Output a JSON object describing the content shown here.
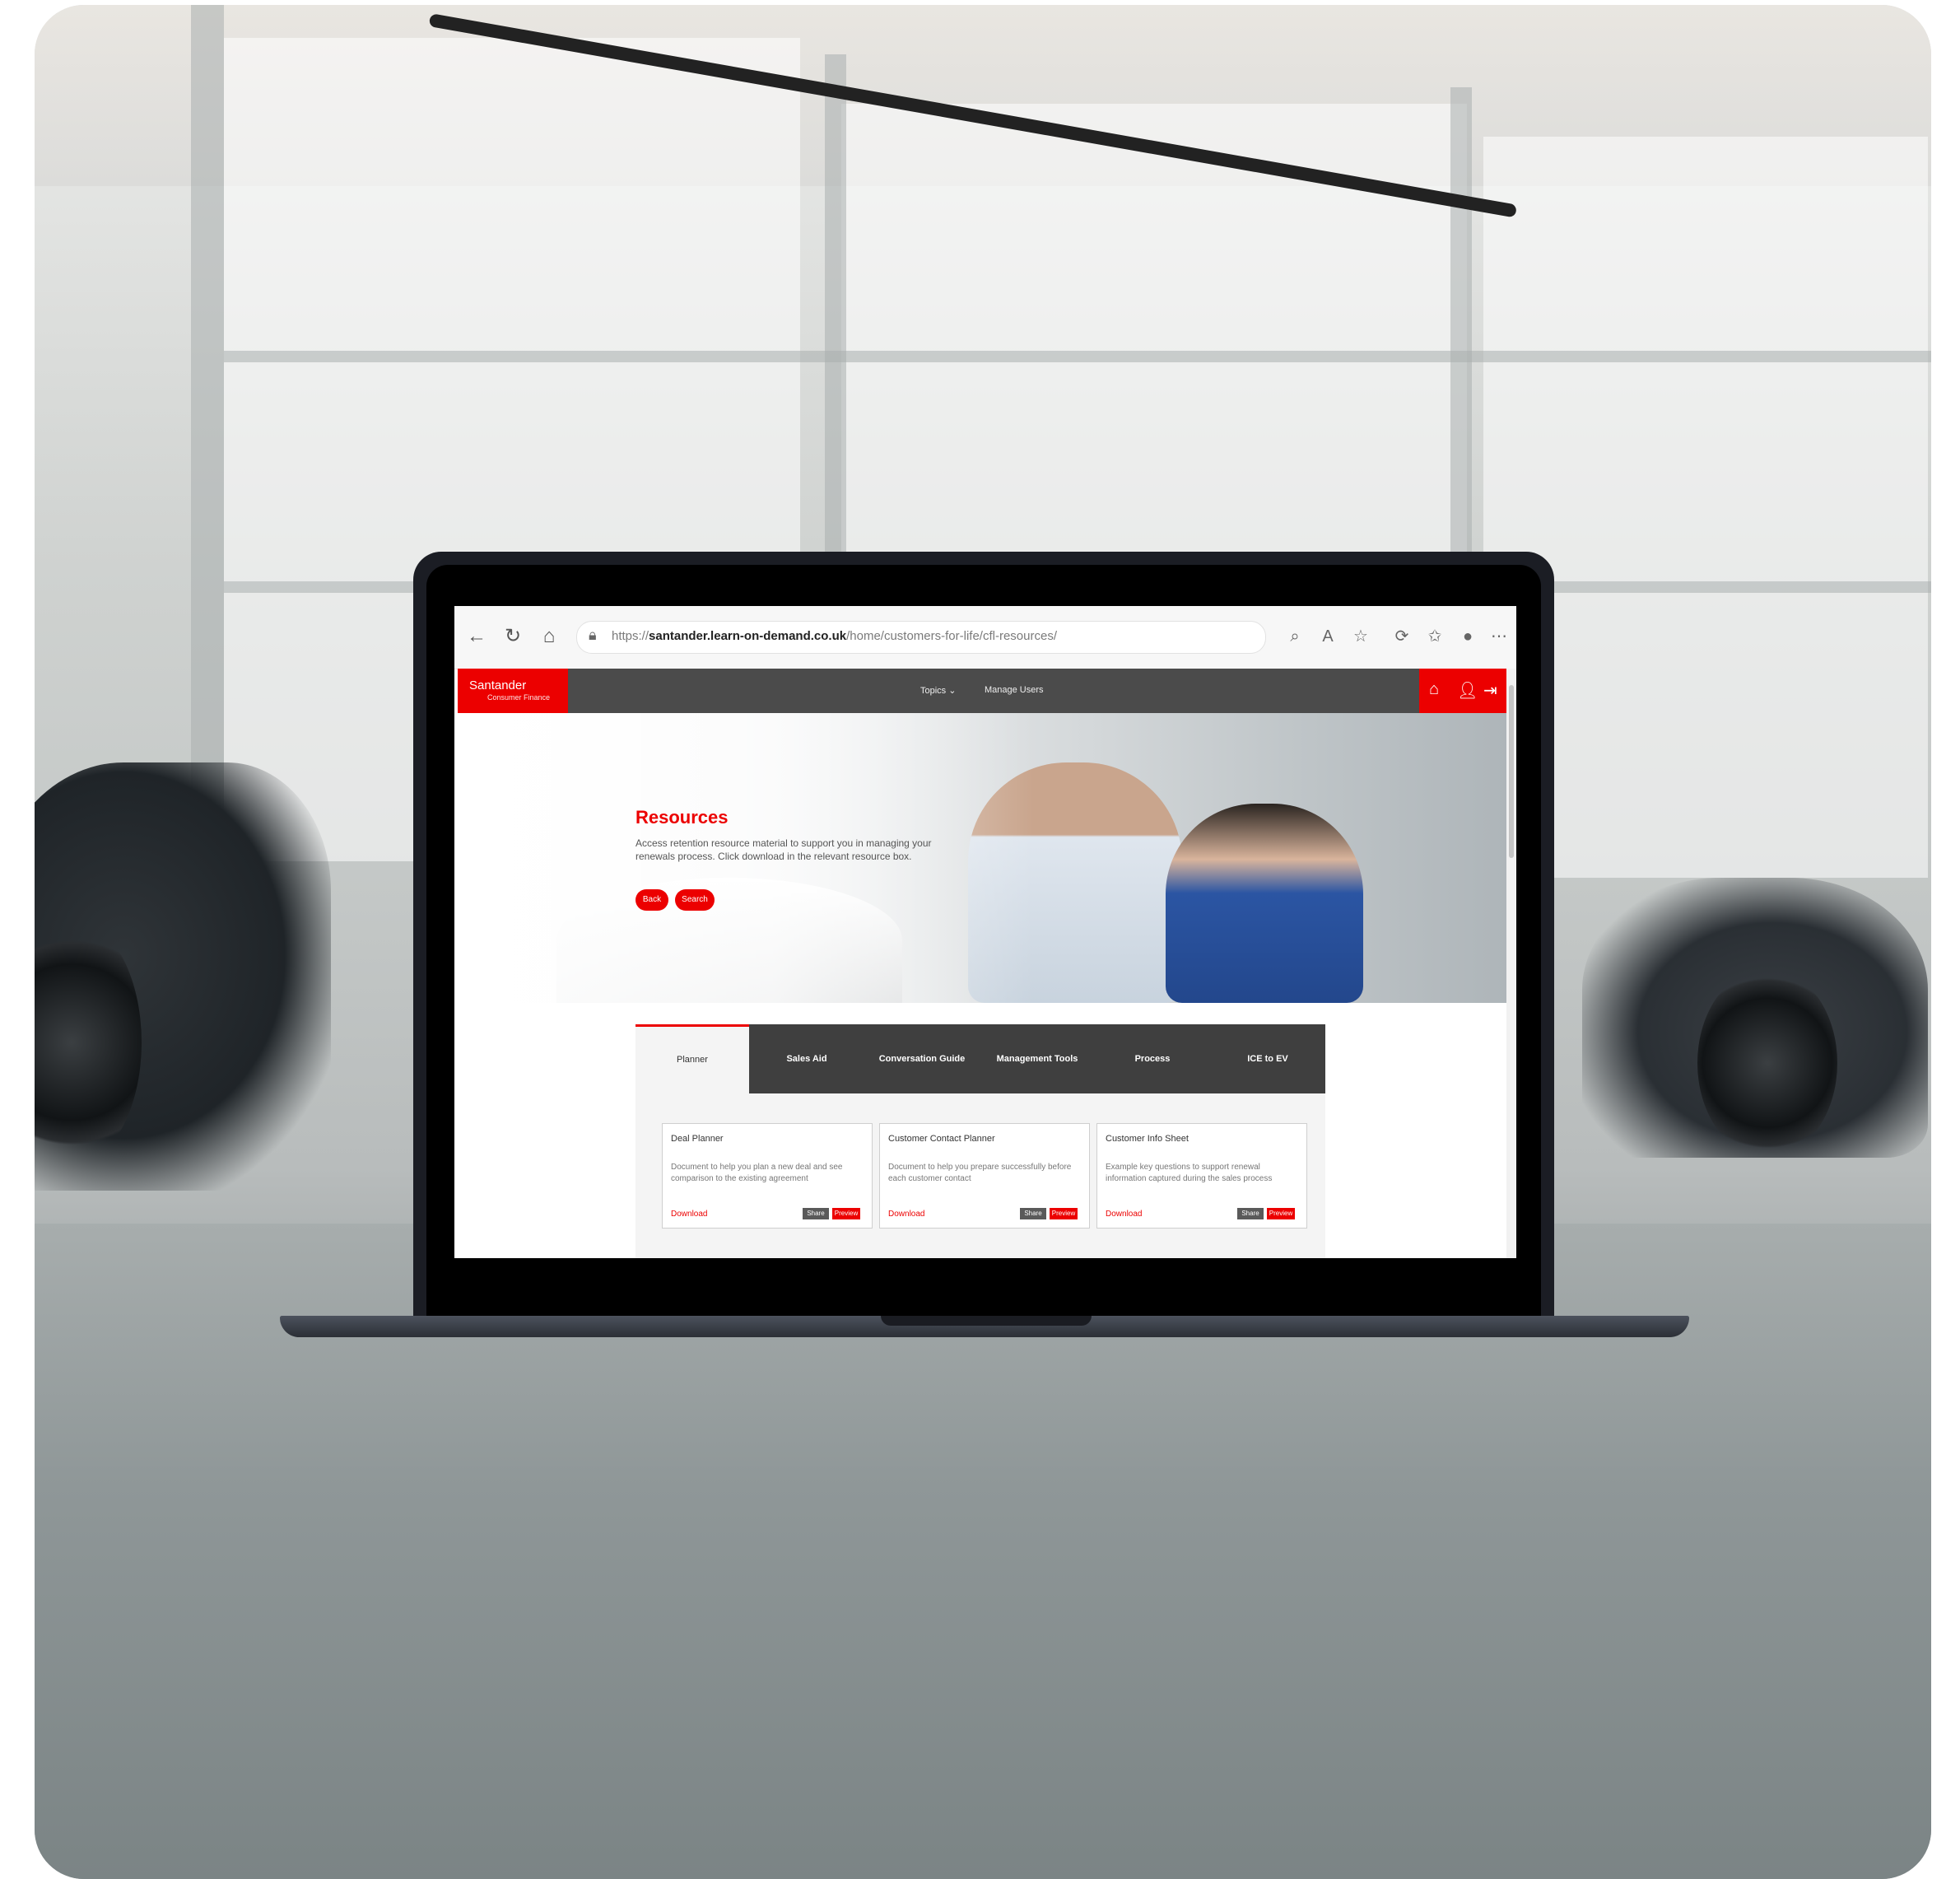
{
  "browser": {
    "url_prefix": "https://",
    "url_domain": "santander.learn-on-demand.co.uk",
    "url_path": "/home/customers-for-life/cfl-resources/"
  },
  "site": {
    "brand": "Santander",
    "brand_sub": "Consumer Finance",
    "menu": [
      "Topics ⌄",
      "Manage Users"
    ]
  },
  "hero": {
    "title": "Resources",
    "description": "Access retention resource material to support you in managing your renewals process. Click download in the relevant resource box.",
    "buttons": [
      "Back",
      "Search"
    ]
  },
  "tabs": [
    "Planner",
    "Sales Aid",
    "Conversation Guide",
    "Management Tools",
    "Process",
    "ICE to EV"
  ],
  "cards": [
    {
      "title": "Deal Planner",
      "text": "Document to help you plan a new deal and see comparison to the existing agreement",
      "download": "Download",
      "btn1": "Share",
      "btn2": "Preview"
    },
    {
      "title": "Customer Contact Planner",
      "text": "Document to help you prepare successfully before each customer contact",
      "download": "Download",
      "btn1": "Share",
      "btn2": "Preview"
    },
    {
      "title": "Customer Info Sheet",
      "text": "Example key questions to support renewal information captured during the sales process",
      "download": "Download",
      "btn1": "Share",
      "btn2": "Preview"
    }
  ],
  "colors": {
    "accent": "#ec0000",
    "nav": "#4b4b4b"
  }
}
